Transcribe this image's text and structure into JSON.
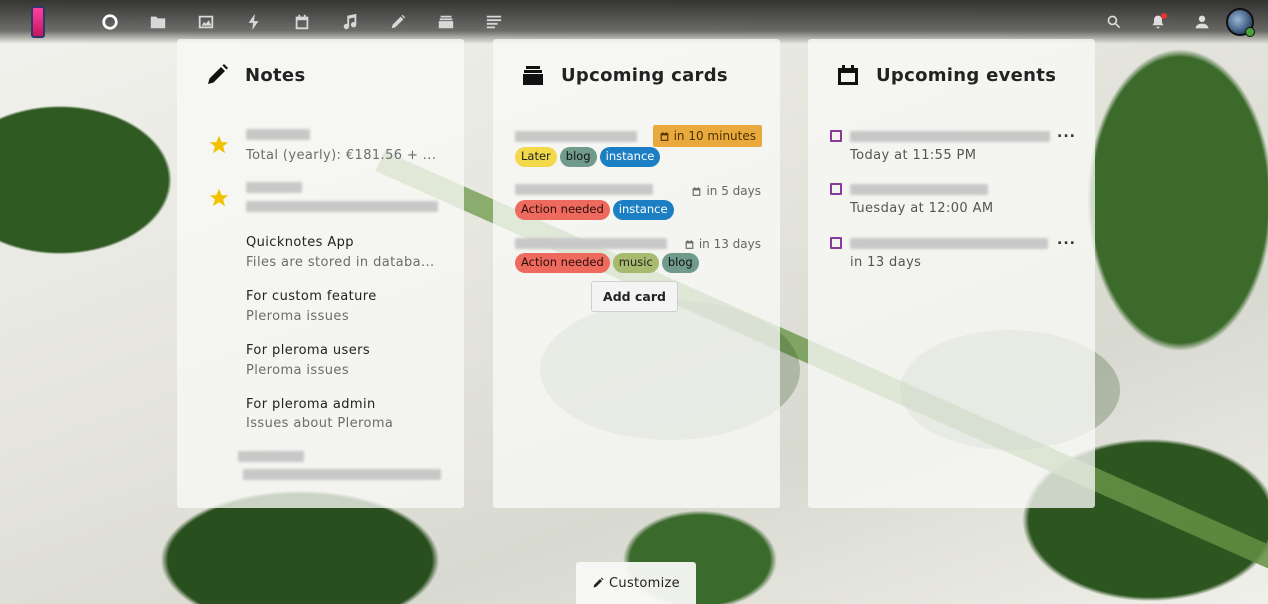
{
  "header": {
    "apps": [
      {
        "name": "dashboard-icon",
        "active": true
      },
      {
        "name": "files-icon"
      },
      {
        "name": "photos-icon"
      },
      {
        "name": "activity-icon"
      },
      {
        "name": "calendar-icon"
      },
      {
        "name": "music-icon"
      },
      {
        "name": "notes-icon"
      },
      {
        "name": "deck-icon"
      },
      {
        "name": "text-icon"
      }
    ],
    "right": [
      "search-icon",
      "notifications-icon",
      "contacts-icon"
    ]
  },
  "notes_panel": {
    "title": "Notes",
    "items": [
      {
        "title": "",
        "subtitle": "Total (yearly): €181.56 + ...",
        "starred": true
      },
      {
        "title": "",
        "subtitle": "",
        "starred": true
      },
      {
        "title": "Quicknotes App",
        "subtitle": "Files are stored in databa...",
        "starred": false
      },
      {
        "title": "For custom feature",
        "subtitle": "Pleroma issues",
        "starred": false
      },
      {
        "title": "For pleroma users",
        "subtitle": "Pleroma issues",
        "starred": false
      },
      {
        "title": "For pleroma admin",
        "subtitle": "Issues about Pleroma",
        "starred": false
      },
      {
        "title": "",
        "subtitle": "",
        "starred": false
      }
    ]
  },
  "cards_panel": {
    "title": "Upcoming cards",
    "cards": [
      {
        "due": "in 10 minutes",
        "urgent": true,
        "labels": [
          {
            "text": "Later",
            "bg": "#f1d94a",
            "fg": "#222"
          },
          {
            "text": "blog",
            "bg": "#6f9a8c",
            "fg": "#111"
          },
          {
            "text": "instance",
            "bg": "#1c7fc4",
            "fg": "#fff"
          }
        ]
      },
      {
        "due": "in 5 days",
        "urgent": false,
        "labels": [
          {
            "text": "Action needed",
            "bg": "#ee6a5f",
            "fg": "#2a0c08"
          },
          {
            "text": "instance",
            "bg": "#1c7fc4",
            "fg": "#fff"
          }
        ]
      },
      {
        "due": "in 13 days",
        "urgent": false,
        "labels": [
          {
            "text": "Action needed",
            "bg": "#ee6a5f",
            "fg": "#2a0c08"
          },
          {
            "text": "music",
            "bg": "#a8ba6d",
            "fg": "#222"
          },
          {
            "text": "blog",
            "bg": "#6f9a8c",
            "fg": "#111"
          }
        ]
      }
    ],
    "add_card_label": "Add card"
  },
  "events_panel": {
    "title": "Upcoming events",
    "events": [
      {
        "when": "Today at 11:55 PM",
        "more": "..."
      },
      {
        "when": "Tuesday at 12:00 AM",
        "more": ""
      },
      {
        "when": "in 13 days",
        "more": "..."
      }
    ]
  },
  "customize_label": "Customize"
}
